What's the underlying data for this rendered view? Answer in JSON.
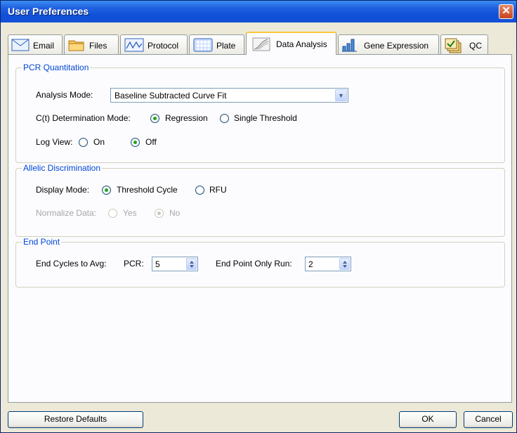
{
  "window": {
    "title": "User Preferences",
    "close_glyph": "✕"
  },
  "tabs": [
    {
      "label": "Email",
      "icon": "envelope-icon"
    },
    {
      "label": "Files",
      "icon": "folder-icon"
    },
    {
      "label": "Protocol",
      "icon": "protocol-icon"
    },
    {
      "label": "Plate",
      "icon": "plate-icon"
    },
    {
      "label": "Data Analysis",
      "icon": "data-analysis-icon",
      "active": true
    },
    {
      "label": "Gene Expression",
      "icon": "gene-expression-icon"
    },
    {
      "label": "QC",
      "icon": "qc-icon"
    }
  ],
  "pcr": {
    "title": "PCR Quantitation",
    "analysis_mode_label": "Analysis Mode:",
    "analysis_mode_value": "Baseline Subtracted Curve Fit",
    "ct_mode_label": "C(t) Determination Mode:",
    "ct_options": [
      "Regression",
      "Single Threshold"
    ],
    "ct_selected": "Regression",
    "log_view_label": "Log View:",
    "log_options": [
      "On",
      "Off"
    ],
    "log_selected": "Off"
  },
  "allelic": {
    "title": "Allelic Discrimination",
    "display_mode_label": "Display Mode:",
    "display_options": [
      "Threshold Cycle",
      "RFU"
    ],
    "display_selected": "Threshold Cycle",
    "normalize_label": "Normalize Data:",
    "normalize_options": [
      "Yes",
      "No"
    ],
    "normalize_selected": "No"
  },
  "endpoint": {
    "title": "End Point",
    "cycles_label": "End Cycles to Avg:",
    "pcr_label": "PCR:",
    "pcr_value": "5",
    "only_run_label": "End Point Only Run:",
    "only_run_value": "2"
  },
  "footer": {
    "restore_label": "Restore Defaults",
    "ok_label": "OK",
    "cancel_label": "Cancel"
  },
  "colors": {
    "title_bar": "#1f5fe0",
    "group_title": "#0046d5",
    "radio_dot": "#21a121",
    "active_tab_accent": "#ffc83c"
  }
}
